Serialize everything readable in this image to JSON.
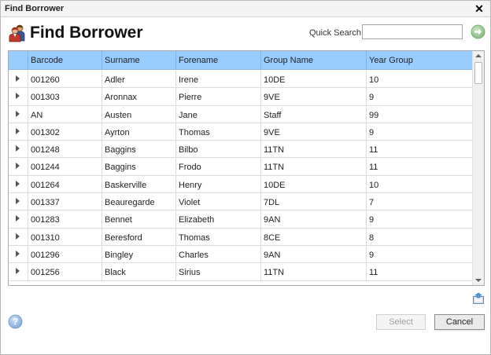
{
  "window": {
    "title": "Find Borrower",
    "close_glyph": "✕"
  },
  "header": {
    "title": "Find Borrower",
    "icon": "borrower-people-icon"
  },
  "search": {
    "label": "Quick Search",
    "value": "",
    "placeholder": "",
    "go_icon": "go-arrow-icon"
  },
  "grid": {
    "columns": [
      "Barcode",
      "Surname",
      "Forename",
      "Group Name",
      "Year Group"
    ],
    "rows": [
      [
        "001260",
        "Adler",
        "Irene",
        "10DE",
        "10"
      ],
      [
        "001303",
        "Aronnax",
        "Pierre",
        "9VE",
        "9"
      ],
      [
        "AN",
        "Austen",
        "Jane",
        "Staff",
        "99"
      ],
      [
        "001302",
        "Ayrton",
        "Thomas",
        "9VE",
        "9"
      ],
      [
        "001248",
        "Baggins",
        "Bilbo",
        "11TN",
        "11"
      ],
      [
        "001244",
        "Baggins",
        "Frodo",
        "11TN",
        "11"
      ],
      [
        "001264",
        "Baskerville",
        "Henry",
        "10DE",
        "10"
      ],
      [
        "001337",
        "Beauregarde",
        "Violet",
        "7DL",
        "7"
      ],
      [
        "001283",
        "Bennet",
        "Elizabeth",
        "9AN",
        "9"
      ],
      [
        "001310",
        "Beresford",
        "Thomas",
        "8CE",
        "8"
      ],
      [
        "001296",
        "Bingley",
        "Charles",
        "9AN",
        "9"
      ],
      [
        "001256",
        "Black",
        "Sirius",
        "11TN",
        "11"
      ]
    ]
  },
  "footer": {
    "select_label": "Select",
    "cancel_label": "Cancel",
    "help_icon": "help-icon",
    "export_icon": "export-icon"
  },
  "colors": {
    "header_blue": "#99ccff",
    "go_green": "#8ec68a"
  }
}
